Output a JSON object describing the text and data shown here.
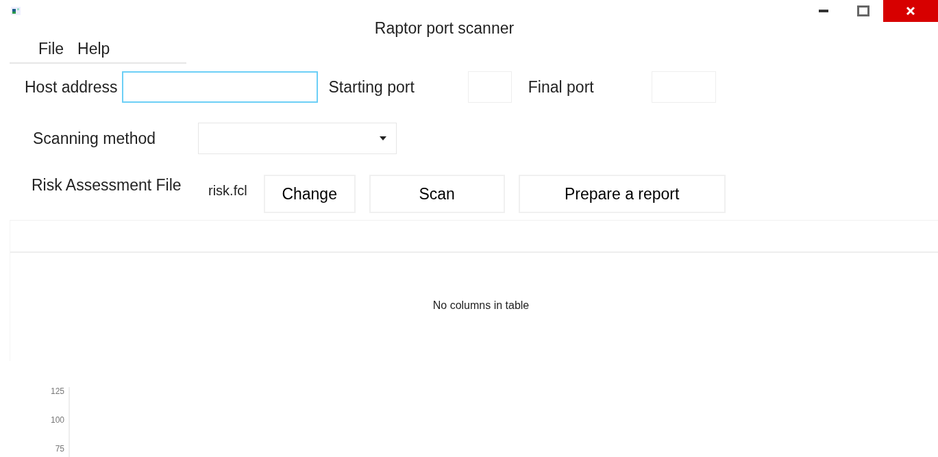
{
  "window": {
    "title": "Raptor port scanner"
  },
  "menu": [
    "File",
    "Help"
  ],
  "host": {
    "label": "Host address"
  },
  "starting_port": {
    "label": "Starting port"
  },
  "final_port": {
    "label": "Final port"
  },
  "scanning_method": {
    "label": "Scanning method"
  },
  "risk_file": {
    "label": "Risk Assessment File",
    "value": "risk.fcl"
  },
  "buttons": [
    "Change",
    "Scan",
    "Prepare a report"
  ],
  "table": {
    "empty_text": "No columns in table"
  },
  "chart": {
    "y_axis_labels": [
      "125",
      "100",
      "75"
    ]
  }
}
